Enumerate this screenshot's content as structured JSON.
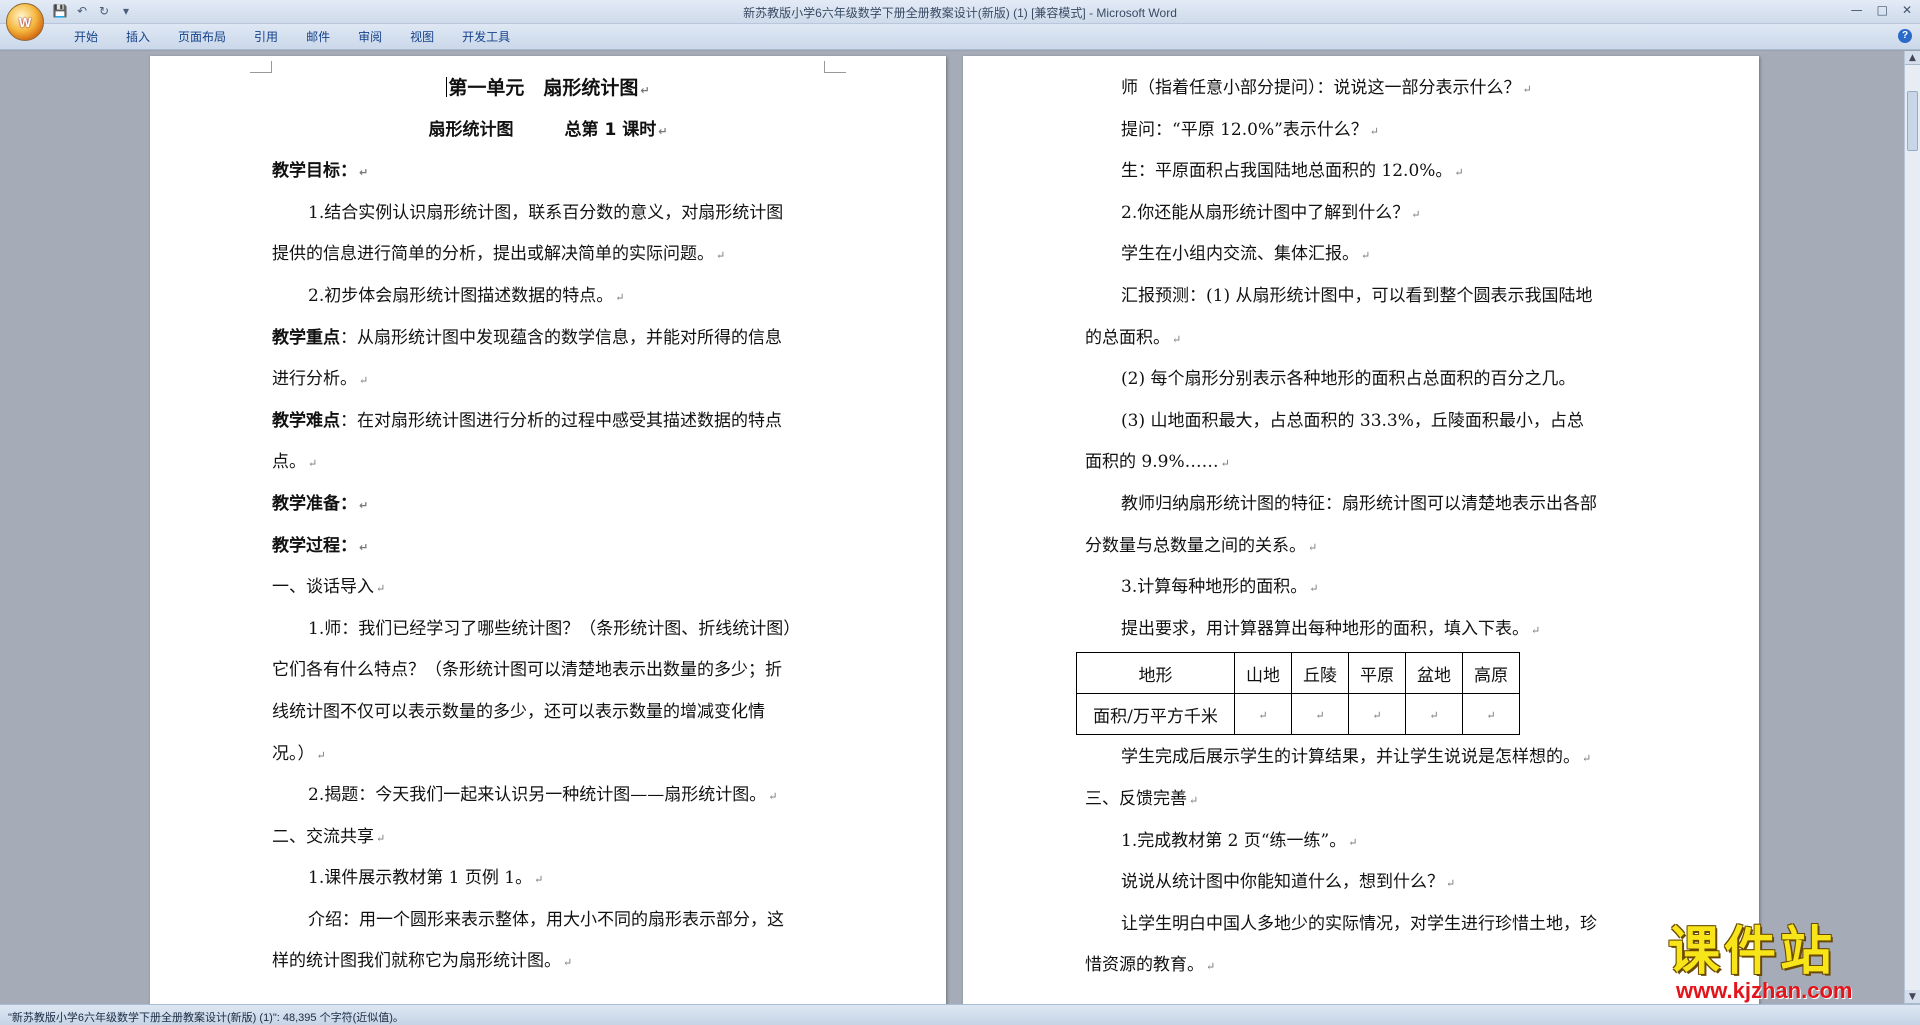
{
  "window": {
    "title": "新苏教版小学6六年级数学下册全册教案设计(新版) (1) [兼容模式] - Microsoft Word",
    "office_button_label": "Office"
  },
  "qat": {
    "save_icon": "save-icon",
    "undo_icon": "undo-icon",
    "redo_icon": "redo-icon",
    "customize_icon": "customize-icon"
  },
  "ribbon": {
    "tabs": [
      "开始",
      "插入",
      "页面布局",
      "引用",
      "邮件",
      "审阅",
      "视图",
      "开发工具"
    ]
  },
  "pages": {
    "left": {
      "title": "第一单元　扇形统计图",
      "subtitle": "扇形统计图　　　总第 1 课时",
      "goal_label": "教学目标：",
      "goal_1a": "1.结合实例认识扇形统计图，联系百分数的意义，对扇形统计图",
      "goal_1b": "提供的信息进行简单的分析，提出或解决简单的实际问题。",
      "goal_2": "2.初步体会扇形统计图描述数据的特点。",
      "key_label": "教学重点",
      "key_a": "：从扇形统计图中发现蕴含的数学信息，并能对所得的信息",
      "key_b": "进行分析。",
      "diff_label": "教学难点",
      "diff_a": "：在对扇形统计图进行分析的过程中感受其描述数据的特点",
      "diff_b": "点。",
      "prep_label": "教学准备：",
      "process_label": "教学过程：",
      "sec1": "一、谈话导入",
      "p1a": "1.师：我们已经学习了哪些统计图？（条形统计图、折线统计图）",
      "p1b": "它们各有什么特点？（条形统计图可以清楚地表示出数量的多少；折",
      "p1c": "线统计图不仅可以表示数量的多少，还可以表示数量的增减变化情",
      "p1d": "况。）",
      "p2": "2.揭题：今天我们一起来认识另一种统计图——扇形统计图。",
      "sec2": "二、交流共享",
      "p3": "1.课件展示教材第 1 页例 1。",
      "p4a": "介绍：用一个圆形来表示整体，用大小不同的扇形表示部分，这",
      "p4b": "样的统计图我们就称它为扇形统计图。"
    },
    "right": {
      "r1": "师（指着任意小部分提问）：说说这一部分表示什么？",
      "r2": "提问：“平原 12.0%”表示什么？",
      "r3": "生：平原面积占我国陆地总面积的 12.0%。",
      "r4": "2.你还能从扇形统计图中了解到什么？",
      "r5": "学生在小组内交流、集体汇报。",
      "r6a": "汇报预测：(1) 从扇形统计图中，可以看到整个圆表示我国陆地",
      "r6b": "的总面积。",
      "r7": "(2) 每个扇形分别表示各种地形的面积占总面积的百分之几。",
      "r8a": "(3) 山地面积最大，占总面积的 33.3%，丘陵面积最小，占总",
      "r8b": "面积的 9.9%……",
      "r9a": "教师归纳扇形统计图的特征：扇形统计图可以清楚地表示出各部",
      "r9b": "分数量与总数量之间的关系。",
      "r10": "3.计算每种地形的面积。",
      "r11": "提出要求，用计算器算出每种地形的面积，填入下表。",
      "table": {
        "header": [
          "地形",
          "山地",
          "丘陵",
          "平原",
          "盆地",
          "高原"
        ],
        "row_label": "面积/万平方千米"
      },
      "r12": "学生完成后展示学生的计算结果，并让学生说说是怎样想的。",
      "sec3": "三、反馈完善",
      "r13": "1.完成教材第 2 页“练一练”。",
      "r14": "说说从统计图中你能知道什么，想到什么？",
      "r15a": "让学生明白中国人多地少的实际情况，对学生进行珍惜土地，珍",
      "r15b": "惜资源的教育。"
    },
    "paragraph_mark": "↵"
  },
  "status": {
    "text": "\"新苏教版小学6六年级数学下册全册教案设计(新版) (1)\": 48,395 个字符(近似值)。"
  },
  "watermark": {
    "main": "课件站",
    "url": "www.kjzhan.com"
  },
  "colors": {
    "ribbon_text": "#15428b",
    "watermark_main": "#f7e51a",
    "watermark_url": "#e4141b"
  }
}
